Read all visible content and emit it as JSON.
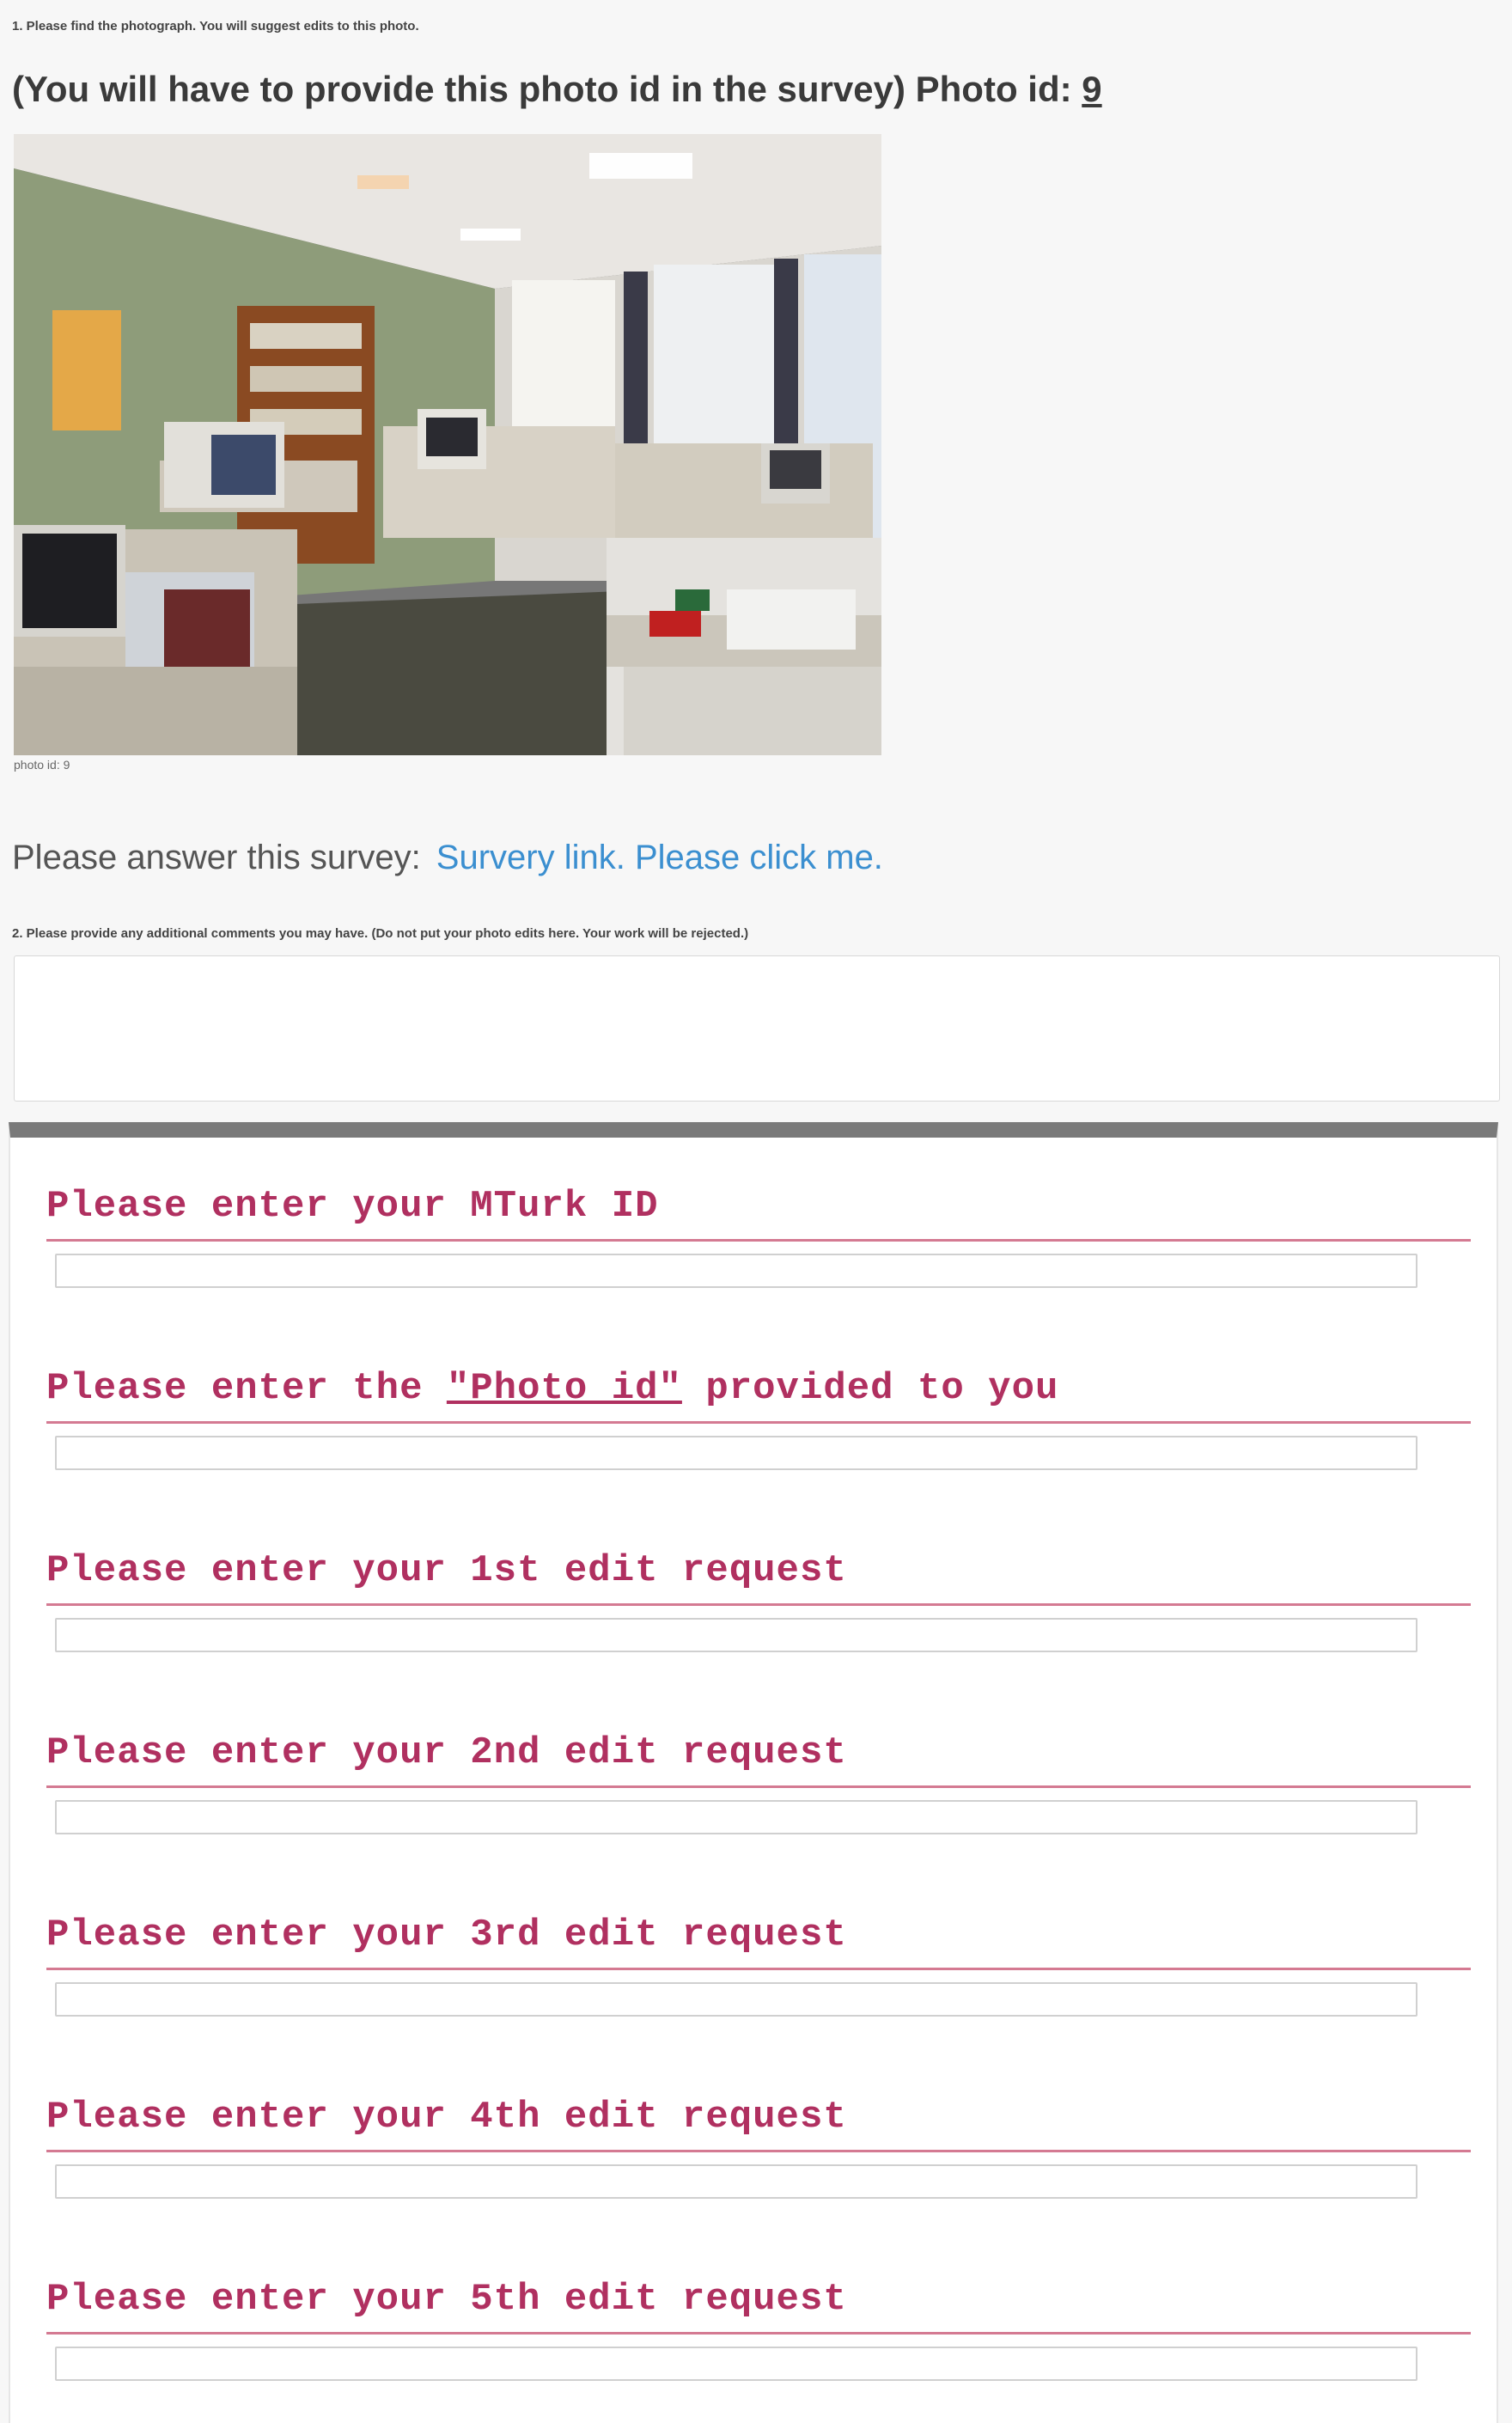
{
  "instruction": "1. Please find the photograph. You will suggest edits to this photo.",
  "photo": {
    "heading_prefix": "(You will have to provide this photo id in the survey) Photo id: ",
    "id": "9",
    "caption": "photo id: 9"
  },
  "survey": {
    "prompt": "Please answer this survey:",
    "link_text": "Survery link. Please click me."
  },
  "comments": {
    "label": "2. Please provide any additional comments you may have. (Do not put your photo edits here. Your work will be rejected.)",
    "value": ""
  },
  "form": {
    "fields": [
      {
        "label": "Please enter your MTurk ID",
        "value": ""
      },
      {
        "label_prefix": "Please enter the ",
        "label_link": "\"Photo id\"",
        "label_suffix": " provided to you",
        "value": ""
      },
      {
        "label": "Please enter your 1st edit request",
        "value": ""
      },
      {
        "label": "Please enter your 2nd edit request",
        "value": ""
      },
      {
        "label": "Please enter your 3rd edit request",
        "value": ""
      },
      {
        "label": "Please enter your 4th edit request",
        "value": ""
      },
      {
        "label": "Please enter your 5th edit request",
        "value": ""
      }
    ]
  },
  "colors": {
    "label": "#b03060",
    "link": "#3b8fd0",
    "panel_header": "#7a7a7a"
  }
}
